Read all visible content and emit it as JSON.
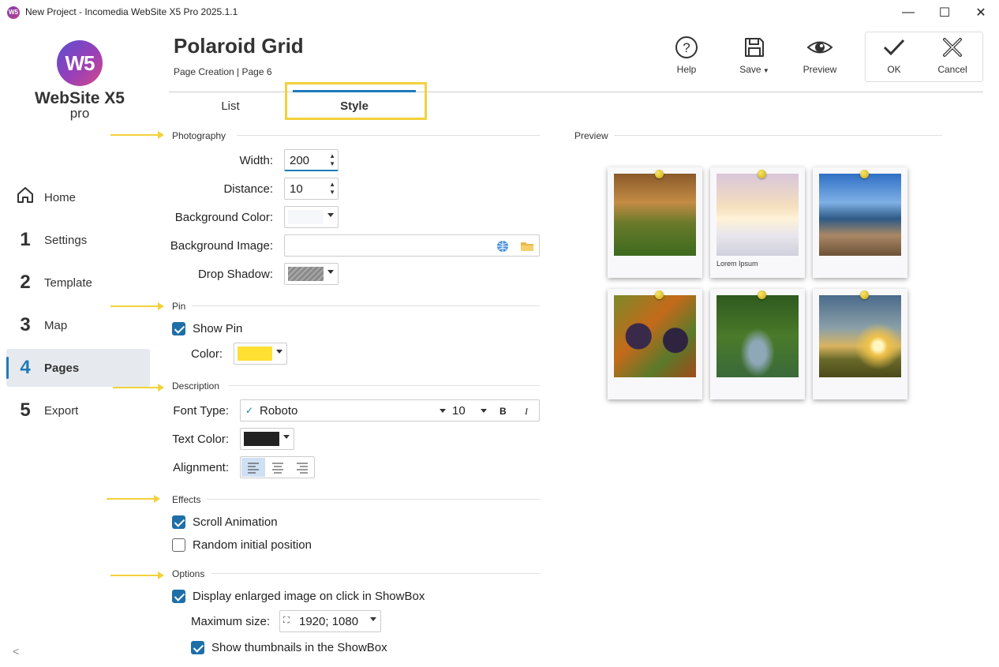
{
  "window": {
    "icon_text": "W5",
    "title": "New Project - Incomedia WebSite X5 Pro 2025.1.1",
    "minimize": "—",
    "maximize": "☐",
    "close": "✕"
  },
  "sidebar": {
    "logo_mark": "W5",
    "logo_text": "WebSite X5",
    "logo_sub": "pro",
    "items": [
      {
        "num": "",
        "label": "Home",
        "icon": "home-icon"
      },
      {
        "num": "1",
        "label": "Settings"
      },
      {
        "num": "2",
        "label": "Template"
      },
      {
        "num": "3",
        "label": "Map"
      },
      {
        "num": "4",
        "label": "Pages",
        "active": true
      },
      {
        "num": "5",
        "label": "Export"
      }
    ],
    "collapse": "<"
  },
  "header": {
    "title": "Polaroid Grid",
    "breadcrumb": "Page Creation | Page 6",
    "help": "Help",
    "save": "Save",
    "preview": "Preview",
    "ok": "OK",
    "cancel": "Cancel"
  },
  "tabs": {
    "list": "List",
    "style": "Style",
    "active": "Style"
  },
  "photography": {
    "title": "Photography",
    "width_label": "Width:",
    "width_value": "200",
    "distance_label": "Distance:",
    "distance_value": "10",
    "bgcolor_label": "Background Color:",
    "bgimage_label": "Background Image:",
    "bgimage_value": "",
    "shadow_label": "Drop Shadow:"
  },
  "pin": {
    "title": "Pin",
    "show_pin": "Show Pin",
    "show_pin_checked": true,
    "color_label": "Color:",
    "color": "#ffe033"
  },
  "description": {
    "title": "Description",
    "font_label": "Font Type:",
    "font_value": "Roboto",
    "font_size": "10",
    "bold": "B",
    "italic": "I",
    "text_color_label": "Text Color:",
    "text_color": "#222222",
    "alignment_label": "Alignment:"
  },
  "effects": {
    "title": "Effects",
    "scroll_animation": "Scroll Animation",
    "scroll_checked": true,
    "random_position": "Random initial position",
    "random_checked": false
  },
  "options": {
    "title": "Options",
    "showbox": "Display enlarged image on click in ShowBox",
    "showbox_checked": true,
    "max_size_label": "Maximum size:",
    "max_size_value": "1920; 1080",
    "thumbnails": "Show thumbnails in the ShowBox",
    "thumbnails_checked": true
  },
  "preview": {
    "title": "Preview",
    "caption": "Lorem Ipsum",
    "photos": [
      "autumn-house",
      "snowy-road",
      "pier-lake",
      "grapes",
      "apple-orchard",
      "sunset-field"
    ]
  },
  "colors": {
    "accent": "#1e7ab8",
    "highlight": "#f3d13b"
  }
}
